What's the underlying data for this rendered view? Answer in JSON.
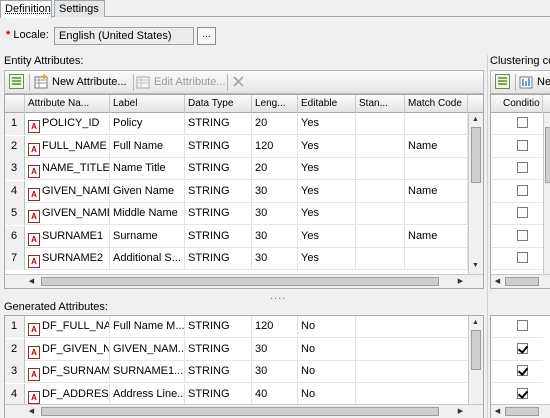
{
  "tabs": [
    {
      "label": "Definition",
      "active": true
    },
    {
      "label": "Settings",
      "active": false
    }
  ],
  "locale": {
    "label": "Locale:",
    "required_mark": "*",
    "value": "English (United States)",
    "browse_label": "..."
  },
  "entity": {
    "section_label": "Entity Attributes:",
    "toolbar": {
      "new_label": "New Attribute...",
      "edit_label": "Edit Attribute..."
    },
    "columns": [
      "Attribute Na...",
      "Label",
      "Data Type",
      "Leng...",
      "Editable",
      "Stan...",
      "Match Code"
    ],
    "rows": [
      {
        "num": "1",
        "name": "POLICY_ID",
        "label": "Policy",
        "type": "STRING",
        "length": "20",
        "editable": "Yes",
        "standard": "",
        "match": ""
      },
      {
        "num": "2",
        "name": "FULL_NAME",
        "label": "Full Name",
        "type": "STRING",
        "length": "120",
        "editable": "Yes",
        "standard": "",
        "match": "Name"
      },
      {
        "num": "3",
        "name": "NAME_TITLE",
        "label": "Name Title",
        "type": "STRING",
        "length": "20",
        "editable": "Yes",
        "standard": "",
        "match": ""
      },
      {
        "num": "4",
        "name": "GIVEN_NAME",
        "label": "Given Name",
        "type": "STRING",
        "length": "30",
        "editable": "Yes",
        "standard": "",
        "match": "Name"
      },
      {
        "num": "5",
        "name": "GIVEN_NAME",
        "label": "Middle Name",
        "type": "STRING",
        "length": "30",
        "editable": "Yes",
        "standard": "",
        "match": ""
      },
      {
        "num": "6",
        "name": "SURNAME1",
        "label": "Surname",
        "type": "STRING",
        "length": "30",
        "editable": "Yes",
        "standard": "",
        "match": "Name"
      },
      {
        "num": "7",
        "name": "SURNAME2",
        "label": "Additional S...",
        "type": "STRING",
        "length": "30",
        "editable": "Yes",
        "standard": "",
        "match": ""
      }
    ]
  },
  "clustering": {
    "section_label": "Clustering co",
    "toolbar_label": "Ne",
    "column": "Conditio",
    "checks": [
      false,
      false,
      false,
      false,
      false,
      false,
      false
    ]
  },
  "generated": {
    "section_label": "Generated Attributes:",
    "rows": [
      {
        "num": "1",
        "name": "DF_FULL_NA",
        "label": "Full Name M...",
        "type": "STRING",
        "length": "120",
        "editable": "No"
      },
      {
        "num": "2",
        "name": "DF_GIVEN_N",
        "label": "GIVEN_NAM...",
        "type": "STRING",
        "length": "30",
        "editable": "No"
      },
      {
        "num": "3",
        "name": "DF_SURNAM",
        "label": "SURNAME1...",
        "type": "STRING",
        "length": "30",
        "editable": "No"
      },
      {
        "num": "4",
        "name": "DF_ADDRESS",
        "label": "Address Line...",
        "type": "STRING",
        "length": "40",
        "editable": "No"
      }
    ],
    "checks": [
      false,
      true,
      true,
      true
    ]
  },
  "splitter_handle": "....",
  "colors": {
    "accent_green": "#5a8f2e",
    "attr_icon_red": "#b00000",
    "required": "#d10000"
  }
}
